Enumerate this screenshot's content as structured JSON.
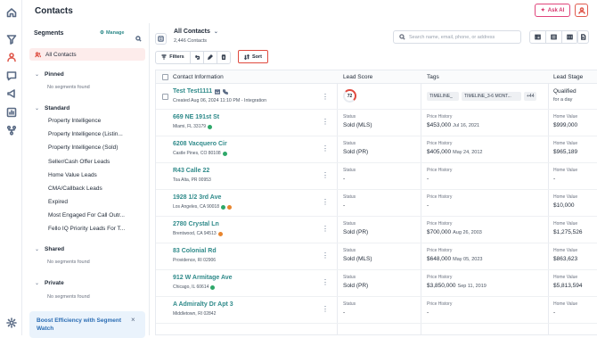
{
  "header": {
    "title": "Contacts",
    "ask_ai": "Ask AI"
  },
  "segments": {
    "title": "Segments",
    "manage": "Manage",
    "all_contacts": "All Contacts",
    "groups": [
      {
        "label": "Pinned",
        "empty": "No segments found"
      },
      {
        "label": "Standard",
        "items": [
          "Property Intelligence",
          "Property Intelligence (Listin...",
          "Property Intelligence (Sold)",
          "Seller/Cash Offer Leads",
          "Home Value Leads",
          "CMA/Callback Leads",
          "Expired",
          "Most Engaged For Call Outr...",
          "Fello IQ Priority Leads For T..."
        ]
      },
      {
        "label": "Shared",
        "empty": "No segments found"
      },
      {
        "label": "Private",
        "empty": "No segments found"
      }
    ],
    "promo": "Boost Efficiency with Segment Watch"
  },
  "view": {
    "name": "All Contacts",
    "count": "2,446 Contacts"
  },
  "search": {
    "placeholder": "Search name, email, phone, or address"
  },
  "toolbar": {
    "filters": "Filters",
    "sort": "Sort"
  },
  "table": {
    "columns": [
      "Contact Information",
      "Lead Score",
      "Tags",
      "Lead Stage"
    ],
    "first": {
      "name": "Test Test1111",
      "created": "Created Aug 06, 2024 11:10 PM - Integration",
      "score": "72",
      "tags": [
        "TIMELINE_",
        "TIMELINE_3-6 MONT...",
        "+44"
      ],
      "stage": "Qualified",
      "stage_sub": "for a day"
    },
    "labels": {
      "status": "Status",
      "price_history": "Price History",
      "home_value": "Home Value"
    },
    "rows": [
      {
        "name": "669 NE 191st St",
        "addr": "Miami, FL 33179",
        "dot": "green",
        "status": "Sold (MLS)",
        "price": "$453,000",
        "date": "Jul 16, 2021",
        "home_value": "$999,000"
      },
      {
        "name": "6208 Vacquero Cir",
        "addr": "Castle Pines, CO 80108",
        "dot": "green",
        "status": "Sold (PR)",
        "price": "$405,000",
        "date": "May 24, 2012",
        "home_value": "$965,189"
      },
      {
        "name": "R43 Calle 22",
        "addr": "Toa Alta, PR 00953",
        "dot": "",
        "status": "-",
        "price": "-",
        "date": "",
        "home_value": "-"
      },
      {
        "name": "1928 1/2 3rd Ave",
        "addr": "Los Angeles, CA 90018",
        "dot": "both",
        "status": "-",
        "price": "-",
        "date": "",
        "home_value": "$10,000"
      },
      {
        "name": "2780 Crystal Ln",
        "addr": "Brentwood, CA 94513",
        "dot": "orange",
        "status": "Sold (PR)",
        "price": "$700,000",
        "date": "Aug 26, 2003",
        "home_value": "$1,275,526"
      },
      {
        "name": "83 Colonial Rd",
        "addr": "Providence, RI 02906",
        "dot": "",
        "status": "Sold (MLS)",
        "price": "$648,000",
        "date": "May 05, 2023",
        "home_value": "$863,623"
      },
      {
        "name": "912 W Armitage Ave",
        "addr": "Chicago, IL 60614",
        "dot": "green",
        "status": "Sold (PR)",
        "price": "$3,850,000",
        "date": "Sep 11, 2019",
        "home_value": "$5,813,594"
      },
      {
        "name": "A Admiralty Dr Apt 3",
        "addr": "Middletown, RI 02842",
        "dot": "",
        "status": "-",
        "price": "-",
        "date": "",
        "home_value": "-"
      }
    ]
  }
}
